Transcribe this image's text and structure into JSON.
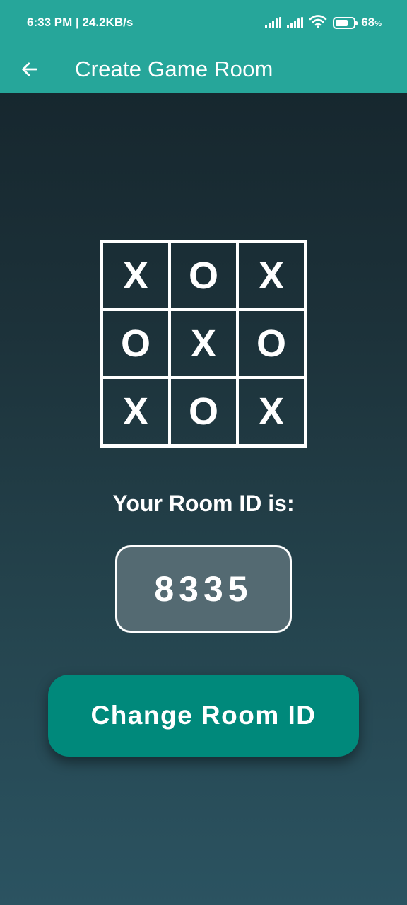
{
  "status_bar": {
    "time_speed": "6:33 PM | 24.2KB/s",
    "battery_percent": "68",
    "battery_level": 0.68,
    "battery_unit": "%"
  },
  "app_bar": {
    "title": "Create Game Room",
    "back_icon": "arrow-left-icon"
  },
  "board": {
    "cells": [
      "X",
      "O",
      "X",
      "O",
      "X",
      "O",
      "X",
      "O",
      "X"
    ]
  },
  "room": {
    "label": "Your Room ID is:",
    "id": "8335"
  },
  "actions": {
    "change_label": "Change Room ID"
  },
  "colors": {
    "accent": "#26a69a",
    "button": "#00897b",
    "id_box": "#546a72"
  }
}
